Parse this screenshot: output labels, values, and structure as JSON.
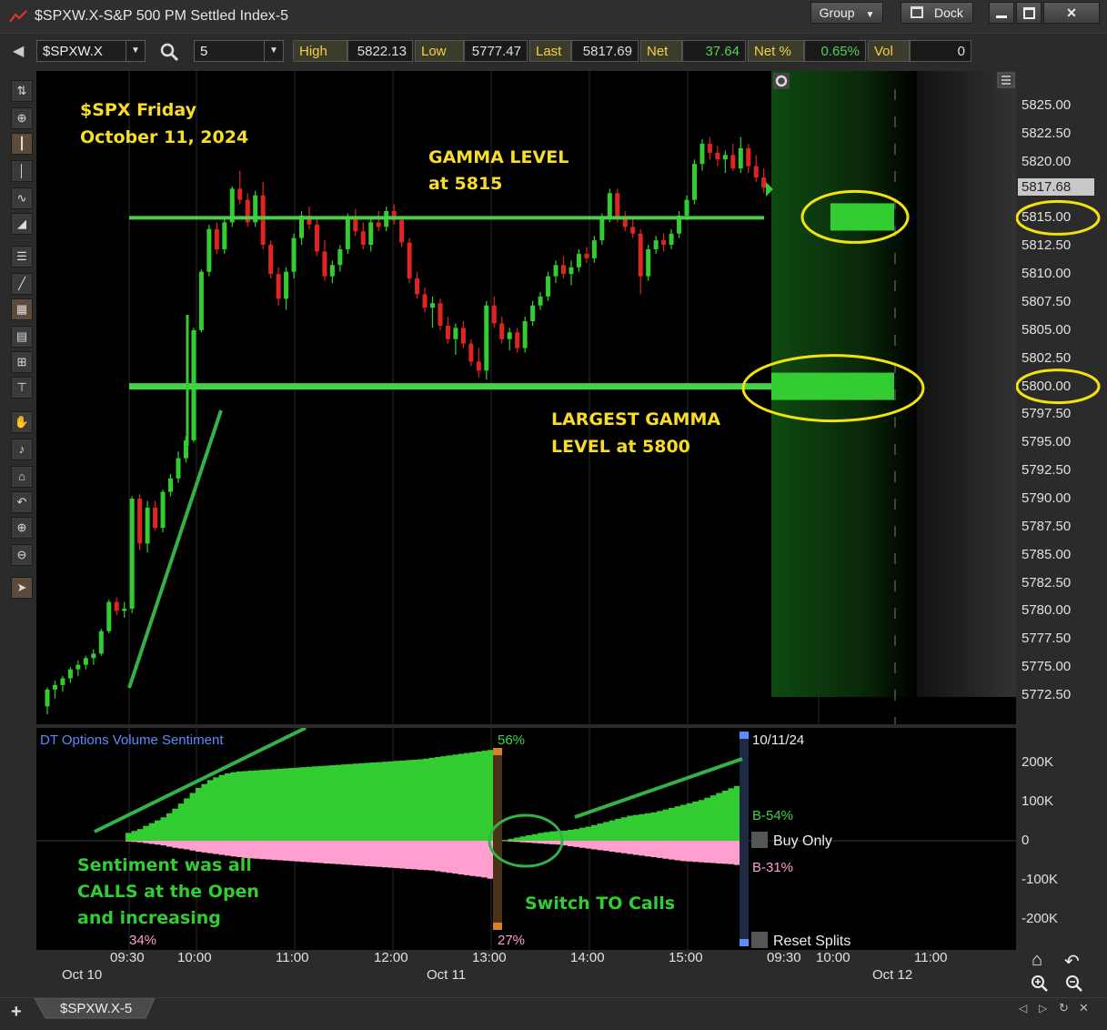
{
  "window": {
    "title": "$SPXW.X-S&P 500 PM Settled Index-5",
    "group_label": "Group",
    "dock_label": "Dock",
    "minimize_icon": "minimize-icon",
    "maximize_icon": "maximize-icon",
    "close_icon": "close-icon",
    "app_icon": "chart-line-icon"
  },
  "toolbar": {
    "symbol": "$SPXW.X",
    "interval": "5",
    "quote": [
      {
        "label": "High",
        "value": "5822.13",
        "green": false
      },
      {
        "label": "Low",
        "value": "5777.47",
        "green": false
      },
      {
        "label": "Last",
        "value": "5817.69",
        "green": false
      },
      {
        "label": "Net",
        "value": "37.64",
        "green": true
      },
      {
        "label": "Net %",
        "value": "0.65%",
        "green": true
      },
      {
        "label": "Vol",
        "value": "0",
        "green": false
      }
    ]
  },
  "tools": [
    "cursor-sync-icon",
    "crosshair-icon",
    "candle-icon",
    "bar-icon",
    "line-icon",
    "area-icon",
    "fib-icon",
    "trendline-icon",
    "grid-icon",
    "table-icon",
    "layout-icon",
    "split-icon",
    "drag-icon",
    "note-icon",
    "home-icon",
    "undo-icon",
    "zoom-in-icon",
    "zoom-out-icon",
    "pointer-icon"
  ],
  "colors": {
    "up": "#33cc33",
    "down": "#e02424",
    "level": "#45d245",
    "annotation_yellow": "#f7dc2a",
    "sentiment_calls": "#33cc33",
    "sentiment_puts": "#ff9fcf",
    "sentiment_title": "#5b8cff",
    "last_price_bg": "#c8c8c8"
  },
  "annotations": {
    "headline_line1": "$SPX Friday",
    "headline_line2": "October 11, 2024",
    "gamma_line1": "GAMMA LEVEL",
    "gamma_line2": "at 5815",
    "largest_line1": "LARGEST GAMMA",
    "largest_line2": "LEVEL at 5800",
    "sentiment_line1": "Sentiment was all",
    "sentiment_line2": "CALLS at the Open",
    "sentiment_line3": "and increasing",
    "switch_text": "Switch TO Calls"
  },
  "chart_data": [
    {
      "type": "candlestick",
      "title": "",
      "ylim": [
        5770,
        5828
      ],
      "y_ticks": [
        "5825.00",
        "5822.50",
        "5820.00",
        "5817.50",
        "5815.00",
        "5812.50",
        "5810.00",
        "5807.50",
        "5805.00",
        "5802.50",
        "5800.00",
        "5797.50",
        "5795.00",
        "5792.50",
        "5790.00",
        "5787.50",
        "5785.00",
        "5782.50",
        "5780.00",
        "5777.50",
        "5775.00",
        "5772.50"
      ],
      "x_ticks": [
        "09:30",
        "10:00",
        "11:00",
        "12:00",
        "13:00",
        "14:00",
        "15:00",
        "09:30",
        "10:00",
        "11:00"
      ],
      "date_labels": [
        "Oct 10",
        "Oct 11",
        "Oct 12"
      ],
      "last_price": "5817.68",
      "gamma_levels": [
        {
          "price": 5815.0,
          "label": "5815.00"
        },
        {
          "price": 5800.0,
          "label": "5800.00"
        }
      ],
      "candles": [
        [
          5771.5,
          5773.2,
          5770.8,
          5773.0
        ],
        [
          5773.0,
          5773.8,
          5772.2,
          5773.4
        ],
        [
          5773.4,
          5774.2,
          5772.8,
          5774.0
        ],
        [
          5774.0,
          5775.0,
          5773.6,
          5774.8
        ],
        [
          5774.8,
          5775.6,
          5774.2,
          5775.2
        ],
        [
          5775.2,
          5776.0,
          5774.8,
          5775.8
        ],
        [
          5775.8,
          5776.6,
          5775.2,
          5776.2
        ],
        [
          5776.2,
          5778.4,
          5776.0,
          5778.2
        ],
        [
          5778.2,
          5781.0,
          5778.0,
          5780.8
        ],
        [
          5780.8,
          5781.2,
          5779.6,
          5780.0
        ],
        [
          5780.0,
          5780.8,
          5779.4,
          5780.2
        ],
        [
          5780.2,
          5790.2,
          5779.8,
          5790.0
        ],
        [
          5790.0,
          5790.4,
          5785.4,
          5786.0
        ],
        [
          5786.0,
          5789.8,
          5785.2,
          5789.2
        ],
        [
          5789.2,
          5789.8,
          5787.2,
          5787.4
        ],
        [
          5787.4,
          5790.8,
          5787.0,
          5790.6
        ],
        [
          5790.6,
          5792.2,
          5790.2,
          5791.8
        ],
        [
          5791.8,
          5794.2,
          5791.4,
          5793.6
        ],
        [
          5793.6,
          5795.6,
          5793.2,
          5795.2
        ],
        [
          5795.2,
          5805.2,
          5795.0,
          5805.0
        ],
        [
          5805.0,
          5810.4,
          5804.8,
          5810.2
        ],
        [
          5810.2,
          5814.4,
          5809.8,
          5814.0
        ],
        [
          5814.0,
          5814.6,
          5811.8,
          5812.2
        ],
        [
          5812.2,
          5815.0,
          5811.8,
          5814.6
        ],
        [
          5814.6,
          5817.8,
          5814.2,
          5817.6
        ],
        [
          5817.6,
          5819.2,
          5816.2,
          5816.6
        ],
        [
          5816.6,
          5817.2,
          5814.2,
          5814.6
        ],
        [
          5814.6,
          5817.4,
          5814.2,
          5817.0
        ],
        [
          5817.0,
          5818.2,
          5812.2,
          5812.6
        ],
        [
          5812.6,
          5813.0,
          5809.6,
          5810.0
        ],
        [
          5810.0,
          5810.6,
          5807.2,
          5807.8
        ],
        [
          5807.8,
          5810.6,
          5806.8,
          5810.2
        ],
        [
          5810.2,
          5813.6,
          5809.6,
          5813.2
        ],
        [
          5813.2,
          5815.6,
          5812.6,
          5815.2
        ],
        [
          5815.2,
          5816.0,
          5814.0,
          5814.4
        ],
        [
          5814.4,
          5815.0,
          5811.6,
          5812.0
        ],
        [
          5812.0,
          5813.0,
          5809.4,
          5809.8
        ],
        [
          5809.8,
          5811.2,
          5809.2,
          5810.8
        ],
        [
          5810.8,
          5812.6,
          5810.2,
          5812.2
        ],
        [
          5812.2,
          5815.4,
          5811.8,
          5815.0
        ],
        [
          5815.0,
          5815.8,
          5813.4,
          5813.8
        ],
        [
          5813.8,
          5814.6,
          5812.2,
          5812.6
        ],
        [
          5812.6,
          5815.0,
          5812.0,
          5814.6
        ],
        [
          5814.6,
          5815.6,
          5813.8,
          5814.2
        ],
        [
          5814.2,
          5816.0,
          5813.8,
          5815.6
        ],
        [
          5815.6,
          5816.2,
          5814.4,
          5814.8
        ],
        [
          5814.8,
          5815.2,
          5812.4,
          5812.8
        ],
        [
          5812.8,
          5813.2,
          5809.2,
          5809.6
        ],
        [
          5809.6,
          5810.2,
          5807.8,
          5808.2
        ],
        [
          5808.2,
          5808.8,
          5806.6,
          5807.0
        ],
        [
          5807.0,
          5808.0,
          5805.2,
          5807.4
        ],
        [
          5807.4,
          5807.8,
          5805.0,
          5805.4
        ],
        [
          5805.4,
          5806.2,
          5803.8,
          5804.2
        ],
        [
          5804.2,
          5805.6,
          5802.8,
          5805.2
        ],
        [
          5805.2,
          5805.8,
          5803.4,
          5803.8
        ],
        [
          5803.8,
          5804.2,
          5801.8,
          5802.2
        ],
        [
          5802.2,
          5803.4,
          5800.8,
          5801.4
        ],
        [
          5801.4,
          5807.6,
          5800.6,
          5807.2
        ],
        [
          5807.2,
          5808.0,
          5805.2,
          5805.6
        ],
        [
          5805.6,
          5806.2,
          5803.8,
          5804.2
        ],
        [
          5804.2,
          5805.2,
          5803.2,
          5804.8
        ],
        [
          5804.8,
          5805.2,
          5803.0,
          5803.4
        ],
        [
          5803.4,
          5806.2,
          5803.0,
          5805.8
        ],
        [
          5805.8,
          5807.6,
          5805.4,
          5807.2
        ],
        [
          5807.2,
          5808.4,
          5806.8,
          5808.0
        ],
        [
          5808.0,
          5810.2,
          5807.6,
          5809.8
        ],
        [
          5809.8,
          5811.2,
          5809.2,
          5810.8
        ],
        [
          5810.8,
          5811.6,
          5809.6,
          5810.0
        ],
        [
          5810.0,
          5811.2,
          5809.0,
          5810.6
        ],
        [
          5810.6,
          5812.2,
          5810.2,
          5811.8
        ],
        [
          5811.8,
          5812.4,
          5811.0,
          5811.4
        ],
        [
          5811.4,
          5813.4,
          5811.0,
          5813.0
        ],
        [
          5813.0,
          5815.4,
          5812.6,
          5815.0
        ],
        [
          5815.0,
          5817.6,
          5814.6,
          5817.2
        ],
        [
          5817.2,
          5817.6,
          5814.6,
          5815.0
        ],
        [
          5815.0,
          5815.6,
          5813.8,
          5814.2
        ],
        [
          5814.2,
          5815.0,
          5813.2,
          5813.6
        ],
        [
          5813.6,
          5814.0,
          5808.2,
          5809.8
        ],
        [
          5809.8,
          5812.6,
          5809.4,
          5812.2
        ],
        [
          5812.2,
          5813.4,
          5811.8,
          5813.0
        ],
        [
          5813.0,
          5813.6,
          5812.0,
          5812.6
        ],
        [
          5812.6,
          5814.0,
          5812.2,
          5813.6
        ],
        [
          5813.6,
          5815.6,
          5813.2,
          5815.2
        ],
        [
          5815.2,
          5817.0,
          5814.8,
          5816.6
        ],
        [
          5816.6,
          5820.2,
          5816.2,
          5819.8
        ],
        [
          5819.8,
          5822.0,
          5819.2,
          5821.6
        ],
        [
          5821.6,
          5822.2,
          5820.2,
          5820.8
        ],
        [
          5820.8,
          5821.4,
          5819.6,
          5820.2
        ],
        [
          5820.2,
          5821.0,
          5819.0,
          5820.6
        ],
        [
          5820.6,
          5821.6,
          5819.2,
          5819.4
        ],
        [
          5819.4,
          5822.2,
          5819.0,
          5821.2
        ],
        [
          5821.2,
          5821.6,
          5819.0,
          5819.6
        ],
        [
          5819.6,
          5820.6,
          5818.2,
          5818.6
        ],
        [
          5818.6,
          5819.4,
          5817.2,
          5817.69
        ]
      ]
    },
    {
      "type": "area",
      "title": "DT Options Volume Sentiment",
      "ylim": [
        -250000,
        250000
      ],
      "y_ticks": [
        "200K",
        "100K",
        "0",
        "-100K",
        "-200K"
      ],
      "series": [
        {
          "name": "B-54%",
          "role": "calls",
          "values": [
            20000,
            25000,
            30000,
            38000,
            45000,
            52000,
            60000,
            70000,
            82000,
            95000,
            108000,
            122000,
            135000,
            145000,
            155000,
            162000,
            168000,
            172000,
            175000,
            177000,
            178000,
            179000,
            180000,
            181000,
            182000,
            183000,
            184000,
            185000,
            186000,
            187000,
            188000,
            189000,
            190000,
            191000,
            192000,
            193000,
            194000,
            195000,
            196000,
            197000,
            198000,
            199000,
            200000,
            201000,
            202000,
            203000,
            204000,
            205000,
            206000,
            207000,
            208000,
            210000,
            212000,
            214000,
            216000,
            218000,
            220000,
            222000,
            224000,
            226000,
            228000,
            230000,
            232000
          ]
        },
        {
          "name": "",
          "role": "puts",
          "values": [
            -2000,
            -3000,
            -4000,
            -6000,
            -8000,
            -10000,
            -12000,
            -15000,
            -18000,
            -20000,
            -22000,
            -25000,
            -28000,
            -30000,
            -32000,
            -34000,
            -36000,
            -38000,
            -40000,
            -42000,
            -44000,
            -45000,
            -46000,
            -47000,
            -48000,
            -49000,
            -50000,
            -51000,
            -52000,
            -53000,
            -54000,
            -55000,
            -56000,
            -57000,
            -58000,
            -59000,
            -60000,
            -61000,
            -62000,
            -63000,
            -64000,
            -65000,
            -66000,
            -67000,
            -68000,
            -69000,
            -70000,
            -71000,
            -72000,
            -73000,
            -74000,
            -75000,
            -76000,
            -78000,
            -80000,
            -82000,
            -84000,
            -86000,
            -88000,
            -90000,
            -92000,
            -94000,
            -97000
          ]
        },
        {
          "name": "",
          "role": "calls_pm",
          "values": [
            2000,
            5000,
            8000,
            11000,
            14000,
            17000,
            20000,
            22000,
            24000,
            25000,
            26000,
            28000,
            30000,
            33000,
            36000,
            40000,
            44000,
            48000,
            52000,
            56000,
            60000,
            64000,
            66000,
            68000,
            70000,
            72000,
            76000,
            80000,
            84000,
            88000,
            92000,
            96000,
            100000,
            104000,
            110000,
            116000,
            122000,
            128000,
            134000,
            140000,
            144000
          ]
        },
        {
          "name": "B-31%",
          "role": "puts_pm",
          "values": [
            -1000,
            -2000,
            -3000,
            -4000,
            -5000,
            -6000,
            -7000,
            -8000,
            -9000,
            -10000,
            -12000,
            -14000,
            -16000,
            -18000,
            -20000,
            -22000,
            -24000,
            -26000,
            -28000,
            -30000,
            -32000,
            -34000,
            -36000,
            -38000,
            -40000,
            -42000,
            -44000,
            -46000,
            -48000,
            -50000,
            -52000,
            -53000,
            -54000,
            -55000,
            -56000,
            -57000,
            -58000,
            -59000,
            -60000,
            -62000,
            -64000
          ]
        }
      ],
      "labels": {
        "top_pct": "56%",
        "bottom_pct": "27%",
        "open_pct": "34%",
        "date": "10/11/24",
        "buy_only": "Buy Only",
        "reset_splits": "Reset Splits"
      }
    }
  ],
  "bottom": {
    "tab_label": "$SPXW.X-5",
    "add_icon": "plus-icon"
  }
}
